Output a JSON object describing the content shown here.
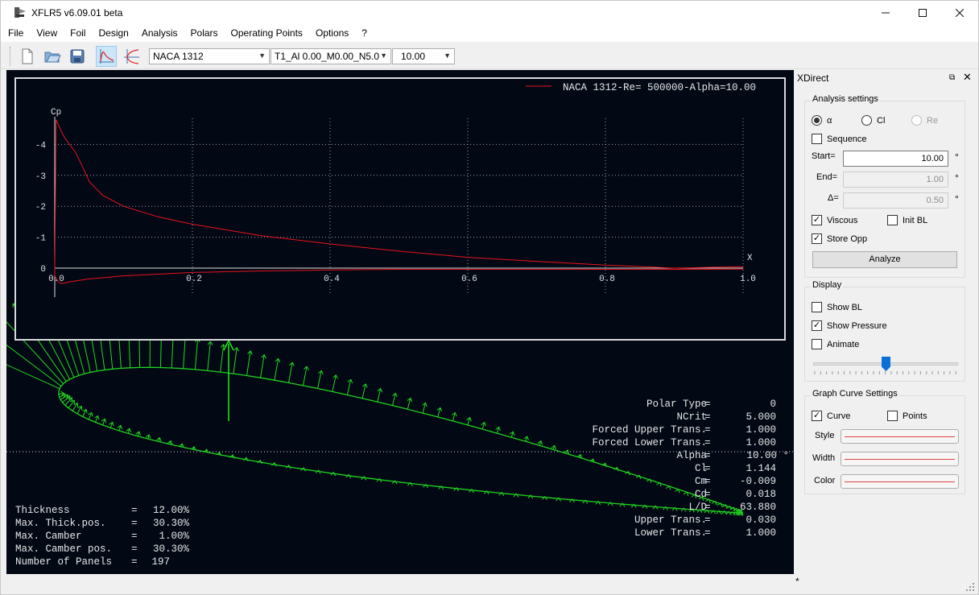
{
  "window": {
    "title": "XFLR5 v6.09.01 beta"
  },
  "menu": [
    "File",
    "View",
    "Foil",
    "Design",
    "Analysis",
    "Polars",
    "Operating Points",
    "Options",
    "?"
  ],
  "toolbar": {
    "foil_select": "NACA 1312",
    "polar_select": "T1_Al 0.00_M0.00_N5.0",
    "opp_select": "10.00",
    "icons": [
      "new-file-icon",
      "open-icon",
      "save-icon",
      "opp-view-icon",
      "polar-view-icon"
    ]
  },
  "graph": {
    "legend": "NACA 1312-Re=  500000-Alpha=10.00",
    "y_title": "Cp",
    "x_title": "X",
    "y_ticks": [
      "-4",
      "-3",
      "-2",
      "-1",
      "0"
    ],
    "x_ticks": [
      "0.0",
      "0.2",
      "0.4",
      "0.6",
      "0.8",
      "1.0"
    ]
  },
  "chart_data": {
    "type": "line",
    "title": "",
    "xlabel": "X",
    "ylabel": "Cp",
    "xlim": [
      0.0,
      1.0
    ],
    "ylim": [
      -4.8,
      1.0
    ],
    "y_reversed": true,
    "grid": true,
    "legend_position": "top-right",
    "series": [
      {
        "name": "NACA 1312-Re=  500000-Alpha=10.00",
        "color": "#e8141c",
        "x": [
          1.0,
          0.9,
          0.8,
          0.7,
          0.6,
          0.5,
          0.4,
          0.3,
          0.2,
          0.15,
          0.1,
          0.07,
          0.05,
          0.04,
          0.03,
          0.02,
          0.015,
          0.01,
          0.005,
          0.002,
          0.0,
          0.0,
          0.005,
          0.01,
          0.02,
          0.05,
          0.1,
          0.2,
          0.3,
          0.4,
          0.5,
          0.6,
          0.7,
          0.8,
          0.9,
          1.0
        ],
        "y": [
          -0.05,
          0.0,
          -0.1,
          -0.22,
          -0.35,
          -0.55,
          -0.78,
          -1.05,
          -1.42,
          -1.66,
          -2.0,
          -2.35,
          -2.8,
          -3.3,
          -3.75,
          -4.05,
          -4.2,
          -4.4,
          -4.65,
          -4.8,
          0.0,
          0.25,
          0.44,
          0.5,
          0.45,
          0.35,
          0.25,
          0.14,
          0.09,
          0.06,
          0.04,
          0.04,
          0.04,
          0.04,
          0.04,
          0.03
        ]
      }
    ]
  },
  "foil_info": {
    "labels": [
      "Thickness",
      "Max. Thick.pos.",
      "Max. Camber",
      "Max. Camber pos.",
      "Number of Panels"
    ],
    "values": [
      "12.00%",
      "30.30%",
      "1.00%",
      "30.30%",
      "197"
    ]
  },
  "opp_info": {
    "labels": [
      "Polar Type",
      "NCrit",
      "Forced Upper Trans.",
      "Forced Lower Trans.",
      "Alpha",
      "Cl",
      "Cm",
      "Cd",
      "L/D",
      "Upper Trans.",
      "Lower Trans."
    ],
    "values": [
      "0",
      "5.000",
      "1.000",
      "1.000",
      "10.00 °",
      "1.144",
      "-0.009",
      "0.018",
      "63.880",
      "0.030",
      "1.000"
    ]
  },
  "dock": {
    "title": "XDirect",
    "analysis": {
      "group_title": "Analysis settings",
      "radio_alpha": "α",
      "radio_cl": "Cl",
      "radio_re": "Re",
      "sequence": "Sequence",
      "start_label": "Start=",
      "start_value": "10.00",
      "end_label": "End=",
      "end_value": "1.00",
      "delta_label": "Δ=",
      "delta_value": "0.50",
      "unit": "°",
      "viscous": "Viscous",
      "init_bl": "Init BL",
      "store_opp": "Store Opp",
      "analyze": "Analyze"
    },
    "display": {
      "group_title": "Display",
      "show_bl": "Show BL",
      "show_pressure": "Show Pressure",
      "animate": "Animate",
      "slider_position": 0.5
    },
    "curve": {
      "group_title": "Graph Curve Settings",
      "curve": "Curve",
      "points": "Points",
      "style": "Style",
      "width": "Width",
      "color": "Color",
      "line_color": "#d44444"
    }
  },
  "status": {
    "text": "*"
  }
}
